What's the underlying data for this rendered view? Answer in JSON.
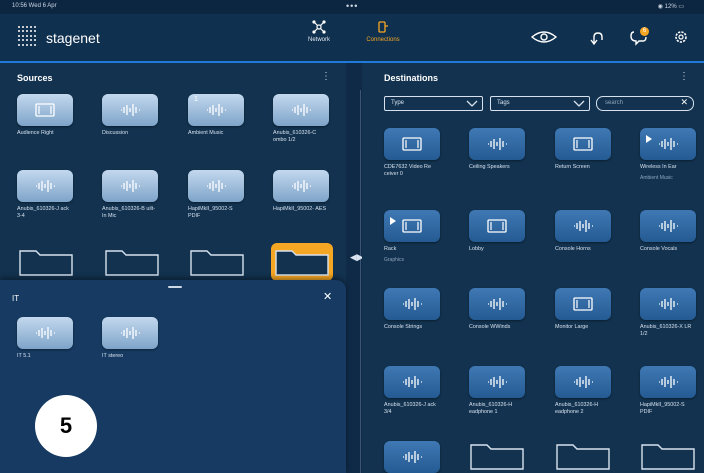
{
  "status": {
    "time": "10:56  Wed 6 Apr",
    "dots": "•••",
    "system": "12%"
  },
  "header": {
    "brand": "stagenet",
    "tabs": [
      {
        "label": "Network",
        "active": false
      },
      {
        "label": "Connections",
        "active": true
      }
    ],
    "notification_count": "6"
  },
  "colors": {
    "accent": "#1f7bd8",
    "active_tab": "#f5a623",
    "folder_selected": "#f5a623"
  },
  "sources": {
    "title": "Sources",
    "tiles": [
      {
        "label": "Audience Right",
        "icon": "screen-icon"
      },
      {
        "label": "Discussion",
        "icon": "waveform-icon"
      },
      {
        "label": "Ambient Music",
        "icon": "waveform-icon",
        "channel": "1"
      },
      {
        "label": "Anubis_610326-C ombo 1/2",
        "icon": "waveform-icon"
      },
      {
        "label": "Anubis_610326-J ack 3-4",
        "icon": "waveform-icon"
      },
      {
        "label": "Anubis_610326-B uilt-In Mic",
        "icon": "waveform-icon"
      },
      {
        "label": "HapiMkII_95002-S PDIF",
        "icon": "waveform-icon"
      },
      {
        "label": "HapiMkII_95002- AES",
        "icon": "waveform-icon"
      }
    ]
  },
  "overlay": {
    "title": "IT",
    "tiles": [
      {
        "label": "IT 5.1",
        "icon": "waveform-icon"
      },
      {
        "label": "IT stereo",
        "icon": "waveform-icon"
      }
    ]
  },
  "step_number": "5",
  "destinations": {
    "title": "Destinations",
    "filter_type": "Type",
    "filter_tags": "Tags",
    "search_placeholder": "search",
    "tiles": [
      {
        "label": "CDE7632 Video Re ceiver 0",
        "icon": "screen-icon",
        "sub": ""
      },
      {
        "label": "Ceiling Speakers",
        "icon": "waveform-icon",
        "sub": ""
      },
      {
        "label": "Return Screen",
        "icon": "screen-icon",
        "sub": ""
      },
      {
        "label": "Wireless In Ear",
        "icon": "waveform-icon",
        "sub": "Ambient Music",
        "play": true
      },
      {
        "label": "Rack",
        "icon": "screen-icon",
        "sub": "Graphics",
        "play": true
      },
      {
        "label": "Lobby",
        "icon": "screen-icon",
        "sub": ""
      },
      {
        "label": "Console Horns",
        "icon": "waveform-icon",
        "sub": ""
      },
      {
        "label": "Console Vocals",
        "icon": "waveform-icon",
        "sub": ""
      },
      {
        "label": "Console Strings",
        "icon": "waveform-icon",
        "sub": ""
      },
      {
        "label": "Console WWinds",
        "icon": "waveform-icon",
        "sub": ""
      },
      {
        "label": "Monitor Large",
        "icon": "screen-icon",
        "sub": ""
      },
      {
        "label": "Anubis_610326-X LR 1/2",
        "icon": "waveform-icon",
        "sub": ""
      },
      {
        "label": "Anubis_610326-J ack 3/4",
        "icon": "waveform-icon",
        "sub": ""
      },
      {
        "label": "Anubis_610326-H eadphone 1",
        "icon": "waveform-icon",
        "sub": ""
      },
      {
        "label": "Anubis_610326-H eadphone 2",
        "icon": "waveform-icon",
        "sub": ""
      },
      {
        "label": "HapiMkII_95002-S PDIF",
        "icon": "waveform-icon",
        "sub": ""
      }
    ]
  }
}
